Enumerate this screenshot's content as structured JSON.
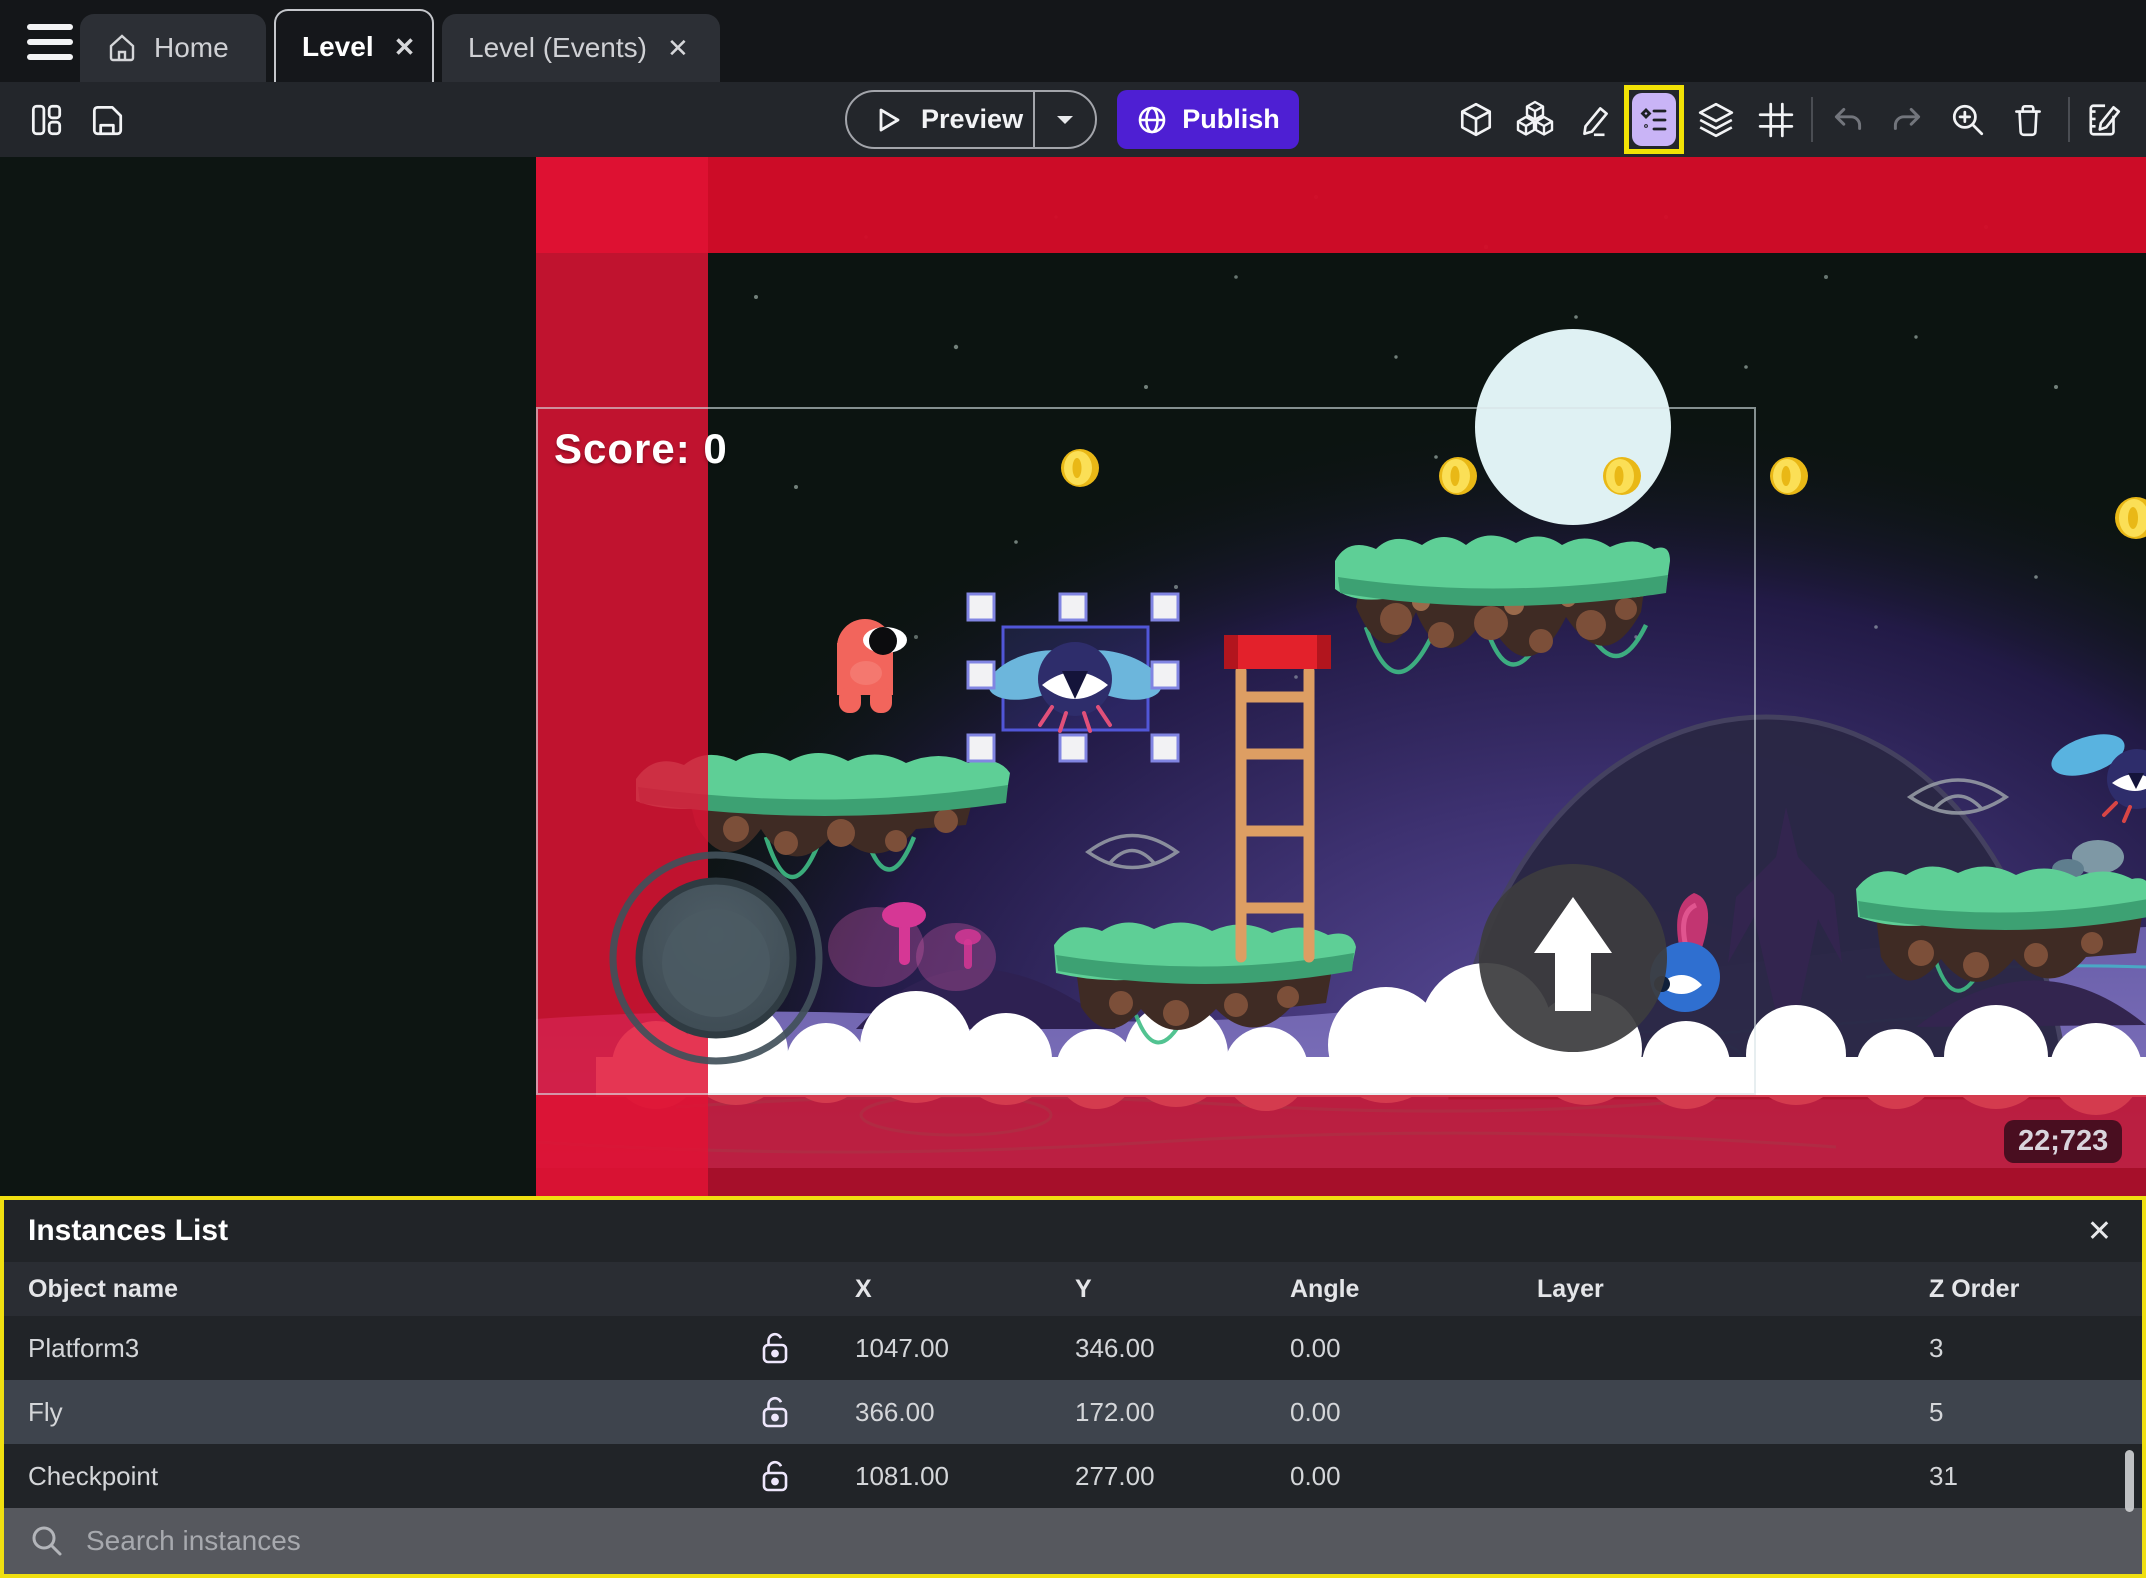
{
  "tabs": {
    "home": "Home",
    "level": "Level",
    "events": "Level (Events)"
  },
  "toolbar": {
    "preview": "Preview",
    "publish": "Publish",
    "left_icons": [
      "layout-panels",
      "save"
    ],
    "right_icons": [
      "object-cube",
      "object-group-cubes",
      "edit-pencil",
      "instances-list",
      "layers",
      "grid",
      "undo",
      "redo",
      "zoom-in",
      "trash",
      "edit-properties"
    ]
  },
  "canvas": {
    "score_text": "Score: 0",
    "coords_badge": "22;723"
  },
  "panel": {
    "title": "Instances List",
    "columns": [
      "Object name",
      "X",
      "Y",
      "Angle",
      "Layer",
      "Z Order"
    ],
    "rows": [
      {
        "name": "Platform3",
        "x": "1047.00",
        "y": "346.00",
        "angle": "0.00",
        "layer": "",
        "z": "3"
      },
      {
        "name": "Fly",
        "x": "366.00",
        "y": "172.00",
        "angle": "0.00",
        "layer": "",
        "z": "5"
      },
      {
        "name": "Checkpoint",
        "x": "1081.00",
        "y": "277.00",
        "angle": "0.00",
        "layer": "",
        "z": "31"
      }
    ],
    "search": {
      "placeholder": "Search instances"
    }
  },
  "colors": {
    "accent_purple": "#4e1fd3",
    "highlight_yellow": "#f0df10",
    "selection_blue": "#5156d8",
    "scene_red_band": "#d30c28",
    "selected_row": "#3e444d"
  }
}
